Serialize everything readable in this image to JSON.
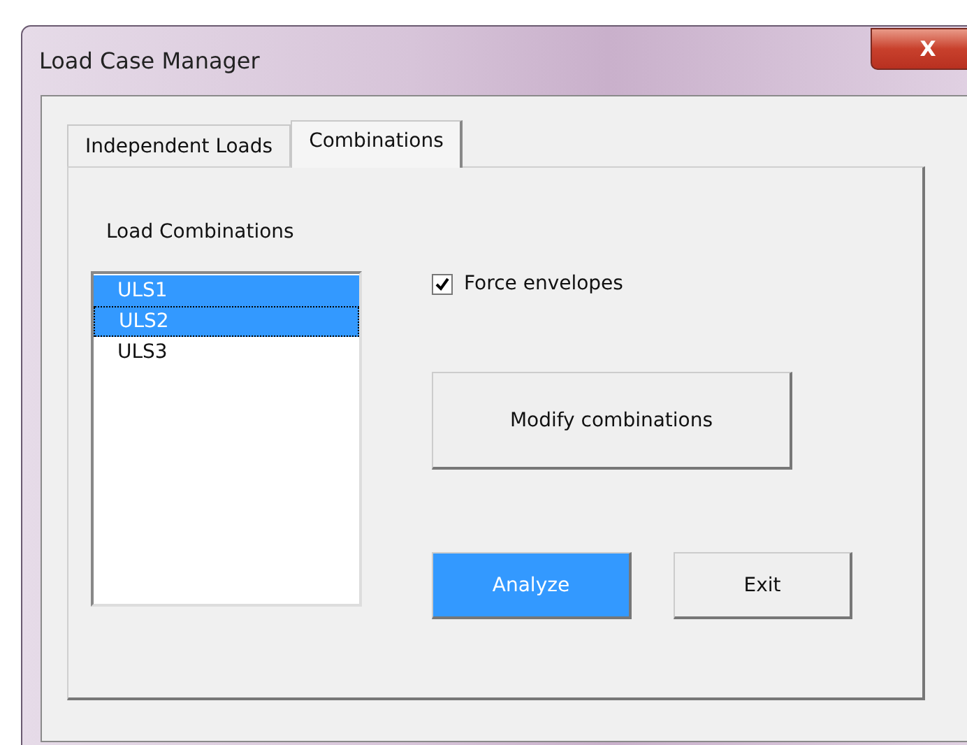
{
  "window": {
    "title": "Load Case Manager",
    "close": "X"
  },
  "tabs": [
    {
      "label": "Independent Loads",
      "selected": false
    },
    {
      "label": "Combinations",
      "selected": true
    }
  ],
  "list": {
    "label": "Load Combinations",
    "items": [
      {
        "text": "ULS1",
        "selected": true,
        "focused": false
      },
      {
        "text": "ULS2",
        "selected": true,
        "focused": true
      },
      {
        "text": "ULS3",
        "selected": false,
        "focused": false
      }
    ]
  },
  "checkbox": {
    "label": "Force envelopes",
    "checked": true
  },
  "modify_button": {
    "label": "Modify combinations",
    "highlighted": false
  },
  "buttons": [
    {
      "label": "Analyze",
      "highlighted": true
    },
    {
      "label": "Exit",
      "highlighted": false
    }
  ]
}
